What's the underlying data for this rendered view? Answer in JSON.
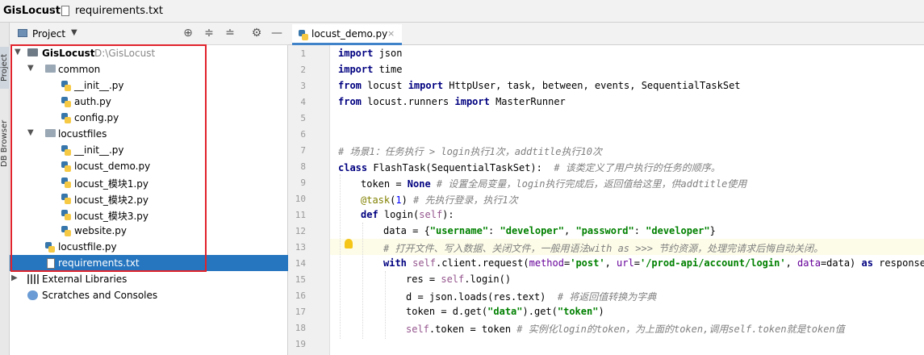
{
  "navbar": {
    "project": "GisLocust",
    "file": "requirements.txt"
  },
  "tool_strip": {
    "project_tab": "Project",
    "db_tab": "DB Browser"
  },
  "project_panel": {
    "title": "Project",
    "tree": {
      "root": {
        "name": "GisLocust",
        "path": "D:\\GisLocust"
      },
      "common": {
        "name": "common",
        "files": [
          "__init__.py",
          "auth.py",
          "config.py"
        ]
      },
      "locustfiles": {
        "name": "locustfiles",
        "files": [
          "__init__.py",
          "locust_demo.py",
          "locust_模块1.py",
          "locust_模块2.py",
          "locust_模块3.py",
          "website.py"
        ]
      },
      "locustfile": "locustfile.py",
      "requirements": "requirements.txt",
      "external": "External Libraries",
      "scratches": "Scratches and Consoles"
    }
  },
  "editor": {
    "tab": "locust_demo.py",
    "line_numbers": [
      "1",
      "2",
      "3",
      "4",
      "5",
      "6",
      "7",
      "8",
      "9",
      "10",
      "11",
      "12",
      "13",
      "14",
      "15",
      "16",
      "17",
      "18",
      "19"
    ],
    "code": {
      "l1": {
        "kw": "import",
        "rest": " json"
      },
      "l2": {
        "kw": "import",
        "rest": " time"
      },
      "l3": {
        "kw1": "from",
        "mod": " locust ",
        "kw2": "import",
        "rest": " HttpUser, task, between, events, SequentialTaskSet"
      },
      "l4": {
        "kw1": "from",
        "mod": " locust.runners ",
        "kw2": "import",
        "rest": " MasterRunner"
      },
      "l7": {
        "comment": "# 场景1：任务执行 > login执行1次，addtitle执行10次"
      },
      "l8": {
        "kw": "class",
        "name": " FlashTask(SequentialTaskSet):  ",
        "comment": "# 该类定义了用户执行的任务的顺序。"
      },
      "l9": {
        "pre": "token = ",
        "kw": "None",
        "comment": " # 设置全局变量，login执行完成后，返回值给这里，供addtitle使用"
      },
      "l10": {
        "dec": "@task",
        "pre": "(",
        "num": "1",
        "post": ")",
        "comment": " # 先执行登录，执行1次"
      },
      "l11": {
        "kw": "def",
        "name": " login(",
        "self": "self",
        "post": "):"
      },
      "l12": {
        "pre": "data = {",
        "s1": "\"username\"",
        "c1": ": ",
        "s2": "\"developer\"",
        "c2": ", ",
        "s3": "\"password\"",
        "c3": ": ",
        "s4": "\"developer\"",
        "post": "}"
      },
      "l13": {
        "comment": "# 打开文件、写入数据、关闭文件，一般用语法with as >>> 节约资源，处理完请求后悔自动关闭。"
      },
      "l14": {
        "kw": "with",
        "self": " self",
        "mid": ".client.request(",
        "k1": "method",
        "e1": "=",
        "s1": "'post'",
        "c1": ", ",
        "k2": "url",
        "e2": "=",
        "s2": "'/prod-api/account/login'",
        "c2": ", ",
        "k3": "data",
        "e3": "=data) ",
        "kw2": "as",
        "post": " response:"
      },
      "l15": {
        "pre": "res = ",
        "self": "self",
        "post": ".login()"
      },
      "l16": {
        "pre": "d = json.loads(res.text)  ",
        "comment": "# 将返回值转换为字典"
      },
      "l17": {
        "pre": "token = d.get(",
        "s1": "\"data\"",
        "mid": ").get(",
        "s2": "\"token\"",
        "post": ")"
      },
      "l18": {
        "self": "self",
        "pre": ".token = token ",
        "comment": "# 实例化login的token，为上面的token,调用self.token就是token值"
      }
    }
  }
}
